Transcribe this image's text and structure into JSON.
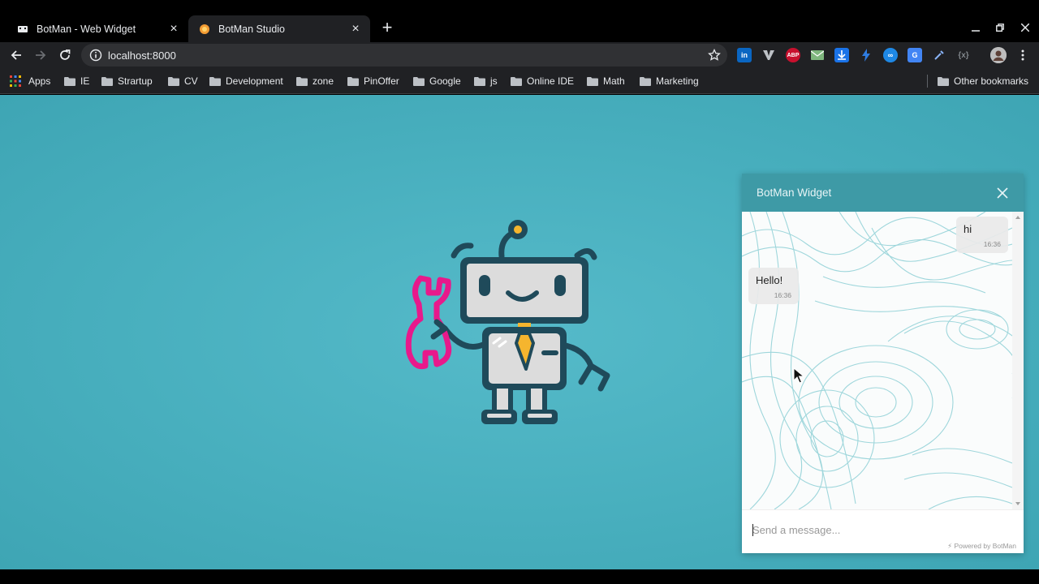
{
  "tabs": [
    {
      "title": "BotMan - Web Widget",
      "favicon": "widget-favicon",
      "active": false
    },
    {
      "title": "BotMan Studio",
      "favicon": "botman-favicon",
      "active": true
    }
  ],
  "toolbar": {
    "url": "localhost:8000"
  },
  "bookmarks": {
    "apps_label": "Apps",
    "folders": [
      "IE",
      "Strartup",
      "CV",
      "Development",
      "zone",
      "PinOffer",
      "Google",
      "js",
      "Online IDE",
      "Math",
      "Marketing"
    ],
    "other_label": "Other bookmarks"
  },
  "widget": {
    "title": "BotMan Widget",
    "messages": [
      {
        "from": "user",
        "text": "hi",
        "time": "16:36"
      },
      {
        "from": "bot",
        "text": "Hello!",
        "time": "16:36"
      }
    ],
    "input_placeholder": "Send a message...",
    "powered_by": "⚡ Powered by BotMan"
  },
  "colors": {
    "page_bg": "#48afbe",
    "widget_header": "#3e9aa6",
    "robot_outline": "#1f4a5a",
    "wrench": "#e8198b",
    "antenna_dot": "#f5b52e"
  }
}
